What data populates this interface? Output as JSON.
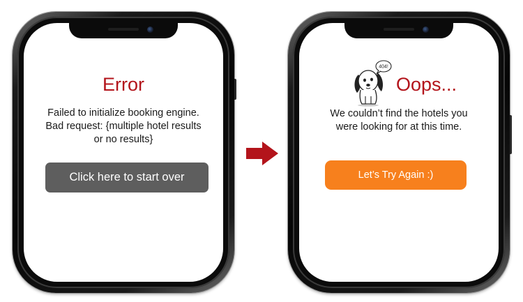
{
  "error_screen": {
    "title": "Error",
    "message_line1": "Failed to initialize booking engine.",
    "message_line2": "Bad request: {multiple hotel results",
    "message_line3": "or no results}",
    "button_label": "Click here to start over"
  },
  "oops_screen": {
    "title": "Oops...",
    "message_line1": "We couldn’t find the hotels you",
    "message_line2": "were looking for at this time.",
    "speech_bubble": "404!",
    "button_label": "Let’s Try Again :)"
  },
  "icons": {
    "transition_arrow": "right-arrow-icon",
    "mascot": "dog-icon"
  },
  "colors": {
    "title_red": "#b3141b",
    "error_button": "#5e5e5e",
    "retry_button": "#f7801d",
    "arrow": "#b3141b"
  }
}
